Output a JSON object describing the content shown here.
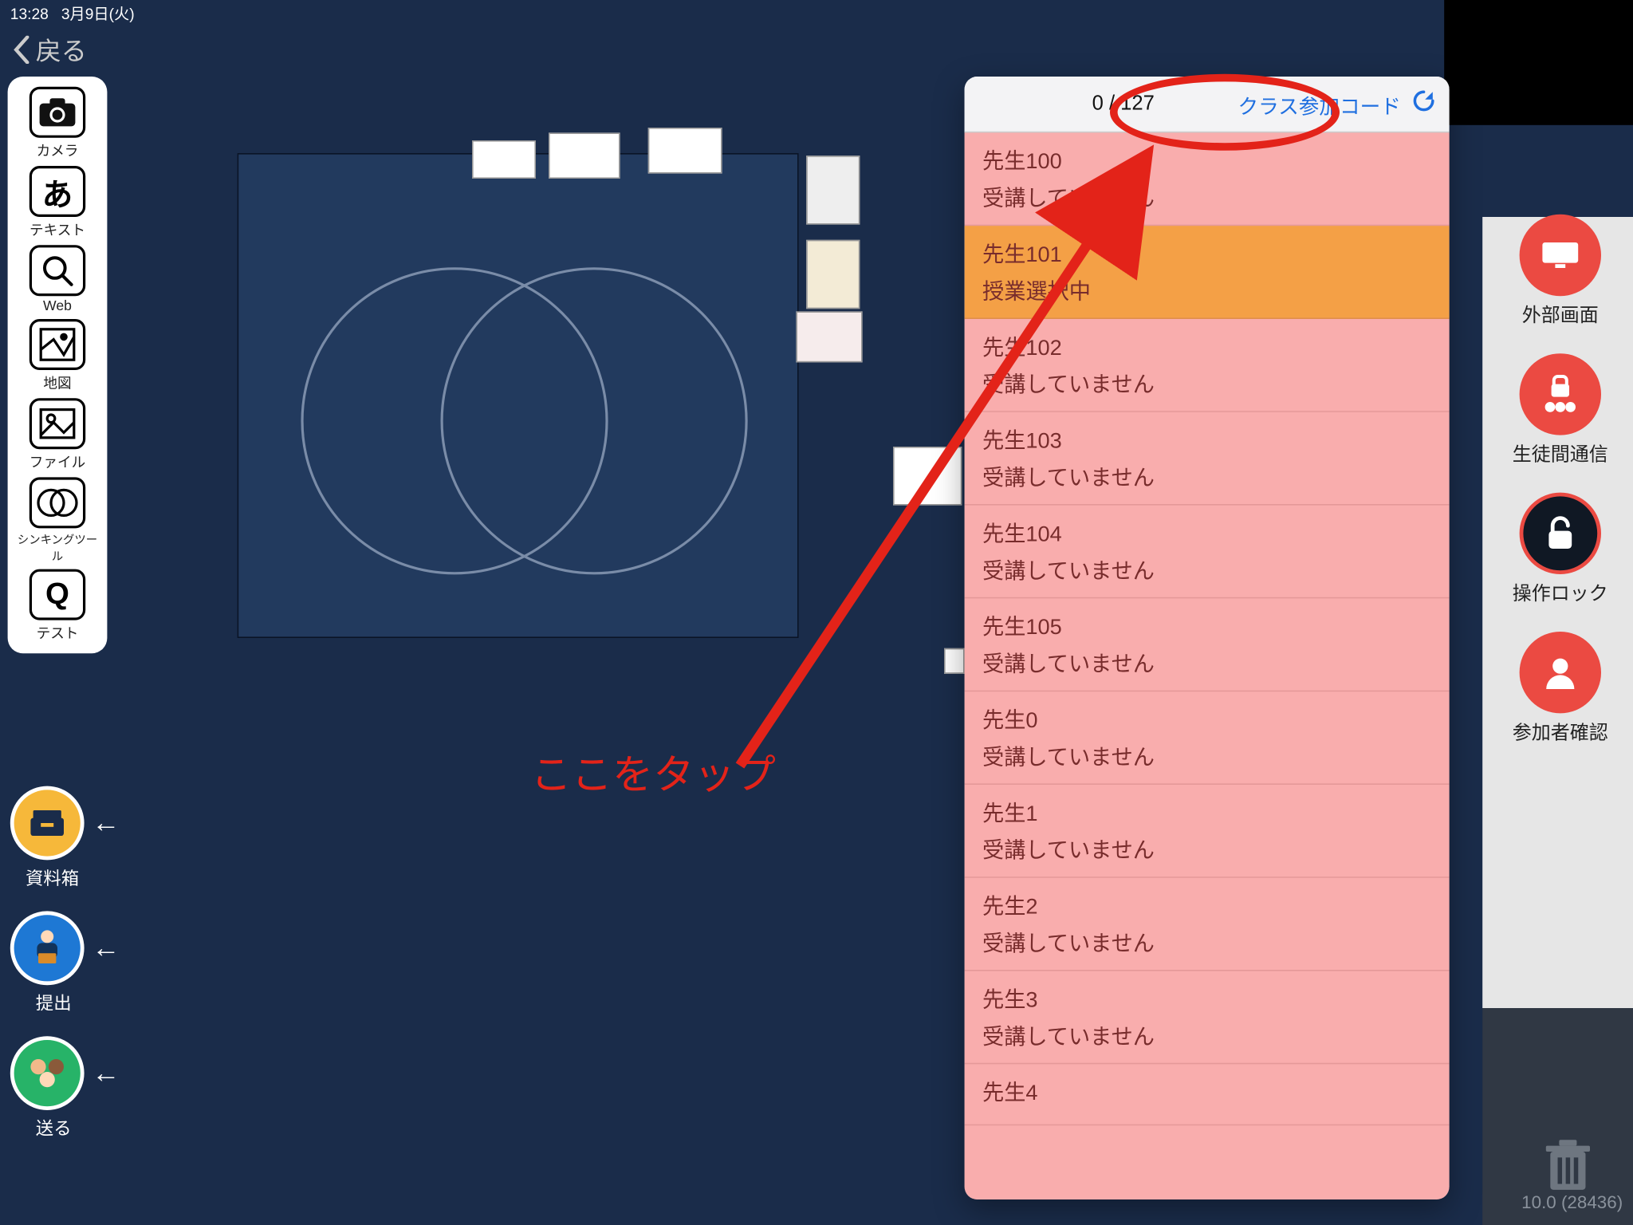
{
  "status": {
    "time": "13:28",
    "date": "3月9日(火)"
  },
  "back_label": "戻る",
  "left_tools": [
    {
      "key": "camera",
      "label": "カメラ"
    },
    {
      "key": "text",
      "label": "テキスト"
    },
    {
      "key": "web",
      "label": "Web"
    },
    {
      "key": "map",
      "label": "地図"
    },
    {
      "key": "file",
      "label": "ファイル"
    },
    {
      "key": "thinking",
      "label": "シンキングツール"
    },
    {
      "key": "test",
      "label": "テスト"
    }
  ],
  "round_buttons": {
    "materials": {
      "label": "資料箱"
    },
    "submit": {
      "label": "提出"
    },
    "send": {
      "label": "送る"
    }
  },
  "right_buttons": {
    "external_screen": "外部画面",
    "student_comm": "生徒間通信",
    "lock": "操作ロック",
    "participants": "参加者確認"
  },
  "popup": {
    "count": "0 / 127",
    "class_code_link": "クラス参加コード",
    "rows": [
      {
        "name": "先生100",
        "status": "受講していません",
        "state": "normal"
      },
      {
        "name": "先生101",
        "status": "授業選択中",
        "state": "yellow"
      },
      {
        "name": "先生102",
        "status": "受講していません",
        "state": "normal"
      },
      {
        "name": "先生103",
        "status": "受講していません",
        "state": "normal"
      },
      {
        "name": "先生104",
        "status": "受講していません",
        "state": "normal"
      },
      {
        "name": "先生105",
        "status": "受講していません",
        "state": "normal"
      },
      {
        "name": "先生0",
        "status": "受講していません",
        "state": "normal"
      },
      {
        "name": "先生1",
        "status": "受講していません",
        "state": "normal"
      },
      {
        "name": "先生2",
        "status": "受講していません",
        "state": "normal"
      },
      {
        "name": "先生3",
        "status": "受講していません",
        "state": "normal"
      },
      {
        "name": "先生4",
        "status": "",
        "state": "normal"
      }
    ]
  },
  "annotation": "ここをタップ",
  "version": "10.0 (28436)"
}
